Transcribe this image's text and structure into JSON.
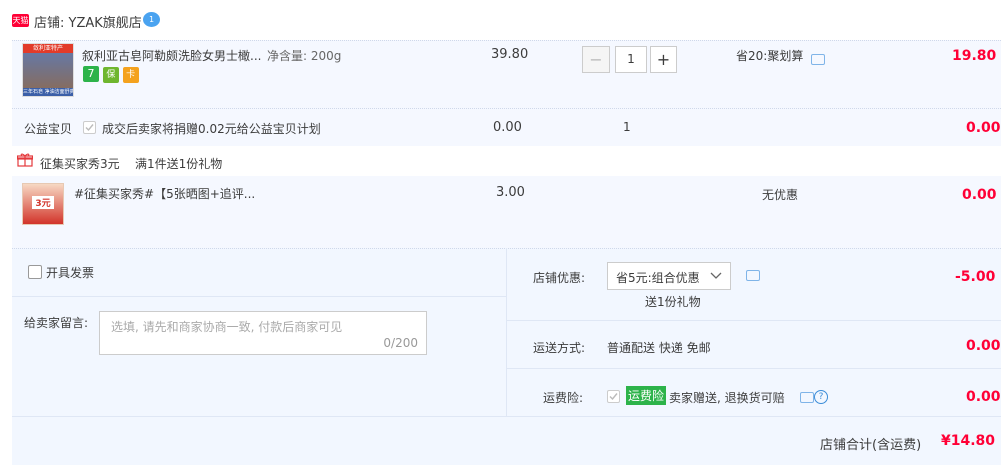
{
  "store": {
    "badge": "天猫",
    "label": "店铺: YZAK旗舰店",
    "im_badge": "1"
  },
  "item1": {
    "thumb_top": "敛利亚特产",
    "thumb_bottom": "三年石皂 净油洁面舒爽",
    "title": "叙利亚古皂阿勒颇洗脸女男士橄...",
    "spec": "净含量: 200g",
    "unit_price": "39.80",
    "qty": "1",
    "minus": "−",
    "plus": "+",
    "promo": "省20:聚划算",
    "subtotal": "19.80",
    "badges": [
      "7",
      "保",
      "卡"
    ]
  },
  "charity": {
    "label": "公益宝贝",
    "text": "成交后卖家将捐赠0.02元给公益宝贝计划",
    "price": "0.00",
    "qty": "1",
    "subtotal": "0.00"
  },
  "gift": {
    "title": "征集买家秀3元",
    "rule": "满1件送1份礼物",
    "thumb_text": "3元",
    "item_title": "#征集买家秀#【5张晒图+追评...",
    "price": "3.00",
    "promo": "无优惠",
    "subtotal": "0.00"
  },
  "invoice": {
    "label": "开具发票"
  },
  "message": {
    "label": "给卖家留言:",
    "placeholder": "选填, 请先和商家协商一致, 付款后商家可见",
    "counter": "0/200"
  },
  "shop_discount": {
    "label": "店铺优惠:",
    "select": "省5元:组合优惠",
    "note": "送1份礼物",
    "amount": "-5.00"
  },
  "shipping": {
    "label": "运送方式:",
    "value": "普通配送 快递 免邮",
    "amount": "0.00"
  },
  "insurance": {
    "label": "运费险:",
    "tag": "运费险",
    "text": "卖家赠送, 退换货可赔",
    "amount": "0.00"
  },
  "total": {
    "label": "店铺合计(含运费)",
    "amount": "¥14.80"
  }
}
